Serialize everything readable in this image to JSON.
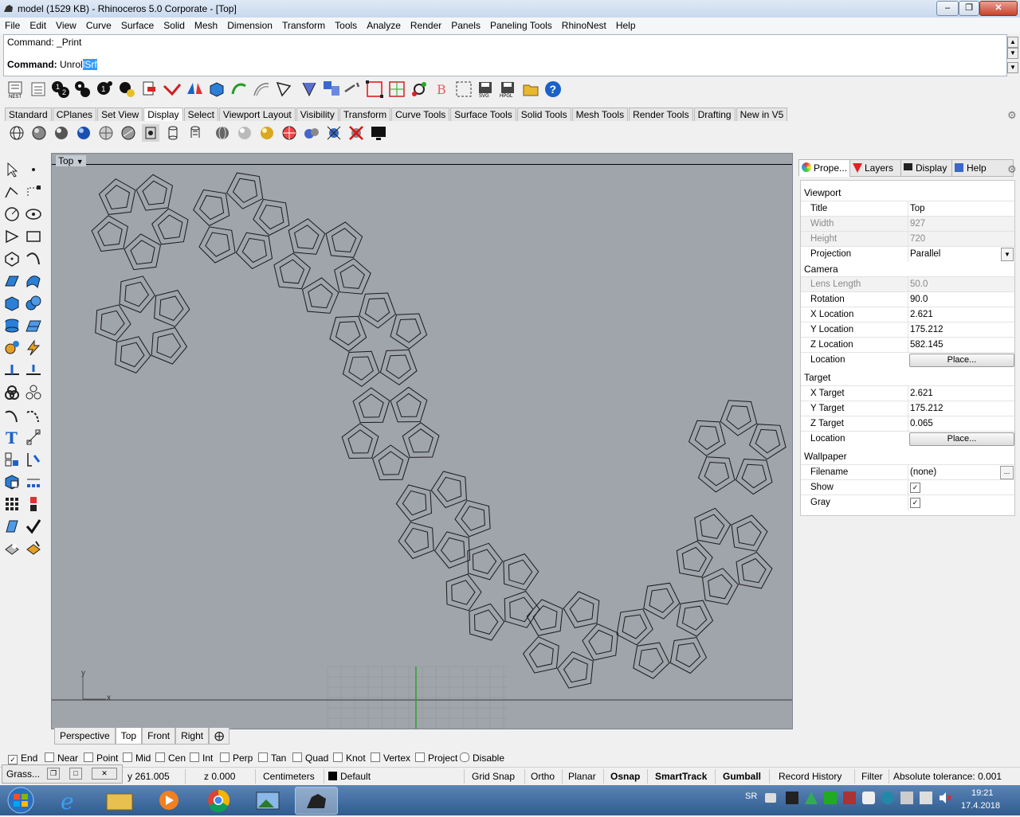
{
  "window": {
    "title": "model (1529 KB) - Rhinoceros  5.0 Corporate - [Top]"
  },
  "menu": [
    "File",
    "Edit",
    "View",
    "Curve",
    "Surface",
    "Solid",
    "Mesh",
    "Dimension",
    "Transform",
    "Tools",
    "Analyze",
    "Render",
    "Panels",
    "Paneling Tools",
    "RhinoNest",
    "Help"
  ],
  "command": {
    "history": "Command: _Print",
    "prompt_label": "Command:",
    "typed": "Unrol",
    "selected": "lSrf"
  },
  "toolbar_tabs": [
    "Standard",
    "CPlanes",
    "Set View",
    "Display",
    "Select",
    "Viewport Layout",
    "Visibility",
    "Transform",
    "Curve Tools",
    "Surface Tools",
    "Solid Tools",
    "Mesh Tools",
    "Render Tools",
    "Drafting",
    "New in V5"
  ],
  "active_toolbar_tab": "Display",
  "toolbar_labels": {
    "nest": "NEST",
    "svg": "SVG",
    "hpgl": "HPGL"
  },
  "viewport": {
    "name": "Top",
    "axis_x": "x",
    "axis_y": "y"
  },
  "viewport_tabs": [
    "Perspective",
    "Top",
    "Front",
    "Right"
  ],
  "active_viewport_tab": "Top",
  "panel_tabs": [
    "Prope...",
    "Layers",
    "Display",
    "Help"
  ],
  "properties": {
    "viewport_section": "Viewport",
    "title_label": "Title",
    "title_value": "Top",
    "width_label": "Width",
    "width_value": "927",
    "height_label": "Height",
    "height_value": "720",
    "projection_label": "Projection",
    "projection_value": "Parallel",
    "camera_section": "Camera",
    "lens_label": "Lens Length",
    "lens_value": "50.0",
    "rotation_label": "Rotation",
    "rotation_value": "90.0",
    "xloc_label": "X Location",
    "xloc_value": "2.621",
    "yloc_label": "Y Location",
    "yloc_value": "175.212",
    "zloc_label": "Z Location",
    "zloc_value": "582.145",
    "location_label": "Location",
    "place_label": "Place...",
    "target_section": "Target",
    "xt_label": "X Target",
    "xt_value": "2.621",
    "yt_label": "Y Target",
    "yt_value": "175.212",
    "zt_label": "Z Target",
    "zt_value": "0.065",
    "location2_label": "Location",
    "place2_label": "Place...",
    "wallpaper_section": "Wallpaper",
    "filename_label": "Filename",
    "filename_value": "(none)",
    "browse_label": "...",
    "show_label": "Show",
    "gray_label": "Gray"
  },
  "osnaps": [
    {
      "label": "End",
      "checked": true
    },
    {
      "label": "Near",
      "checked": false
    },
    {
      "label": "Point",
      "checked": false
    },
    {
      "label": "Mid",
      "checked": false
    },
    {
      "label": "Cen",
      "checked": false
    },
    {
      "label": "Int",
      "checked": false
    },
    {
      "label": "Perp",
      "checked": false
    },
    {
      "label": "Tan",
      "checked": false
    },
    {
      "label": "Quad",
      "checked": false
    },
    {
      "label": "Knot",
      "checked": false
    },
    {
      "label": "Vertex",
      "checked": false
    },
    {
      "label": "Project",
      "checked": false
    },
    {
      "label": "Disable",
      "checked": false
    }
  ],
  "status": {
    "grasshopper": "Grass...",
    "y": "y 261.005",
    "z": "z 0.000",
    "units": "Centimeters",
    "layer": "Default",
    "grid_snap": "Grid Snap",
    "ortho": "Ortho",
    "planar": "Planar",
    "osnap": "Osnap",
    "smarttrack": "SmartTrack",
    "gumball": "Gumball",
    "record_history": "Record History",
    "filter": "Filter",
    "tolerance": "Absolute tolerance: 0.001"
  },
  "taskbar": {
    "lang": "SR",
    "time": "19:21",
    "date": "17.4.2018"
  },
  "colors": {
    "viewport_bg": "#a0a4ab",
    "selection": "#3399ff",
    "taskbar": "#2f5b8f"
  }
}
